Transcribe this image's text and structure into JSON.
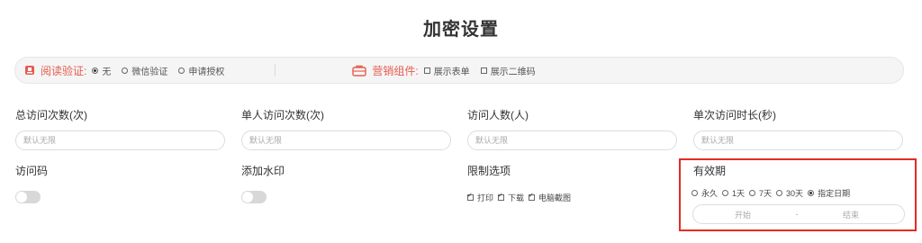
{
  "page": {
    "title": "加密设置"
  },
  "options_bar": {
    "read_verify": {
      "label": "阅读验证:",
      "options": [
        {
          "label": "无",
          "checked": true
        },
        {
          "label": "微信验证",
          "checked": false
        },
        {
          "label": "申请授权",
          "checked": false
        }
      ]
    },
    "marketing": {
      "label": "营销组件:",
      "options": [
        {
          "label": "展示表单",
          "checked": false
        },
        {
          "label": "展示二维码",
          "checked": false
        }
      ]
    },
    "accent_color": "#e65c4f"
  },
  "fields": {
    "total_visits": {
      "label": "总访问次数(次)",
      "placeholder": "默认无限"
    },
    "per_person_visits": {
      "label": "单人访问次数(次)",
      "placeholder": "默认无限"
    },
    "visitors": {
      "label": "访问人数(人)",
      "placeholder": "默认无限"
    },
    "single_duration": {
      "label": "单次访问时长(秒)",
      "placeholder": "默认无限"
    },
    "access_code": {
      "label": "访问码",
      "enabled": false
    },
    "watermark": {
      "label": "添加水印",
      "enabled": false
    },
    "restrictions": {
      "label": "限制选项",
      "options": [
        {
          "label": "打印",
          "checked": true
        },
        {
          "label": "下载",
          "checked": true
        },
        {
          "label": "电脑截图",
          "checked": true
        }
      ]
    },
    "validity": {
      "label": "有效期",
      "options": [
        {
          "label": "永久",
          "checked": false
        },
        {
          "label": "1天",
          "checked": false
        },
        {
          "label": "7天",
          "checked": false
        },
        {
          "label": "30天",
          "checked": false
        },
        {
          "label": "指定日期",
          "checked": true
        }
      ],
      "start_placeholder": "开始",
      "separator": "-",
      "end_placeholder": "结束",
      "highlight_color": "#e42b24"
    }
  }
}
